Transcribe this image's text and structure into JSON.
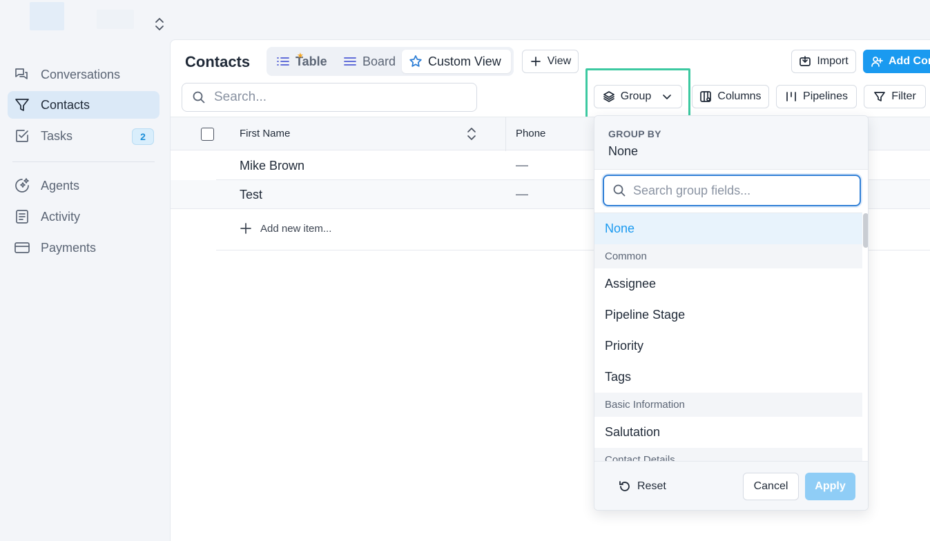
{
  "sidebar": {
    "items": [
      {
        "label": "Conversations",
        "icon": "chat-icon"
      },
      {
        "label": "Contacts",
        "icon": "filter-icon",
        "active": true
      },
      {
        "label": "Tasks",
        "icon": "check-square-icon",
        "badge": "2"
      },
      {
        "label": "Agents",
        "icon": "sparkle-agent-icon"
      },
      {
        "label": "Activity",
        "icon": "list-doc-icon"
      },
      {
        "label": "Payments",
        "icon": "card-icon"
      }
    ]
  },
  "header": {
    "title": "Contacts",
    "tabs": [
      {
        "label": "Table"
      },
      {
        "label": "Board"
      },
      {
        "label": "Custom View"
      }
    ],
    "view_button": "View",
    "import_button": "Import",
    "add_button": "Add Con"
  },
  "toolbar": {
    "search_placeholder": "Search...",
    "group": "Group",
    "columns": "Columns",
    "pipelines": "Pipelines",
    "filter": "Filter"
  },
  "table": {
    "columns": [
      "First Name",
      "Phone"
    ],
    "rows": [
      {
        "name": "Mike Brown",
        "phone": "—"
      },
      {
        "name": "Test",
        "phone": "—"
      }
    ],
    "add_item": "Add new item..."
  },
  "group_dropdown": {
    "label": "GROUP BY",
    "current": "None",
    "search_placeholder": "Search group fields...",
    "options": {
      "none": "None",
      "common": "Common",
      "assignee": "Assignee",
      "pipeline_stage": "Pipeline Stage",
      "priority": "Priority",
      "tags": "Tags",
      "basic_info": "Basic Information",
      "salutation": "Salutation",
      "contact_details": "Contact Details"
    },
    "reset": "Reset",
    "cancel": "Cancel",
    "apply": "Apply"
  },
  "colors": {
    "accent": "#1a9af0",
    "highlight": "#3cc9a1"
  }
}
